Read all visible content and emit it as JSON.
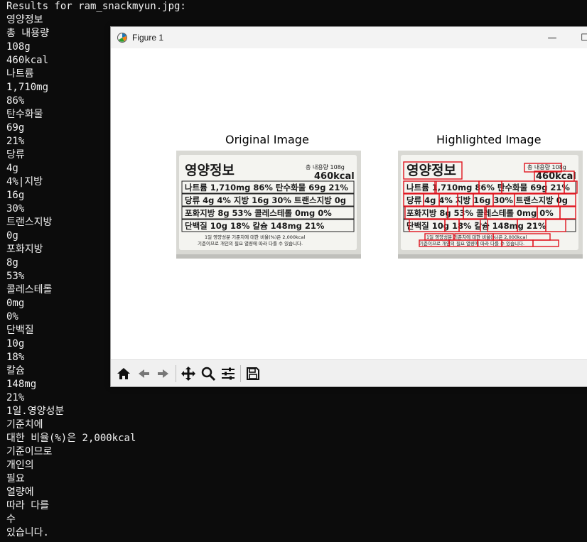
{
  "terminal": {
    "lines": [
      "Results for ram_snackmyun.jpg:",
      "영양정보",
      "총 내용량",
      "108g",
      "460kcal",
      "나트륨",
      "1,710mg",
      "86%",
      "탄수화물",
      "69g",
      "21%",
      "당류",
      "4g",
      "4%|지방",
      "16g",
      "30%",
      "트랜스지방",
      "0g",
      "포화지방",
      "8g",
      "53%",
      "콜레스테롤",
      "0mg",
      "0%",
      "단백질",
      "10g",
      "18%",
      "칼슘",
      "148mg",
      "21%",
      "1일.영양성분",
      "기준치에",
      "대한 비율(%)은 2,000kcal",
      "기준이므로",
      "개인의",
      "필요",
      "열량에",
      "따라 다를",
      "수",
      "있습니다."
    ]
  },
  "figure": {
    "window_title": "Figure 1",
    "minimize_glyph": "—",
    "maximize_glyph": "☐",
    "original_title": "Original Image",
    "highlighted_title": "Highlighted Image"
  },
  "label": {
    "heading": "영양정보",
    "total": "총 내용량 108g",
    "kcal": "460kcal",
    "row1": "나트륨 1,710mg 86% 탄수화물 69g 21%",
    "row2": "당류 4g 4% 지방 16g 30% 트랜스지방 0g",
    "row3": "포화지방 8g 53% 콜레스테롤 0mg 0%",
    "row4": "단백질 10g 18% 칼슘 148mg 21%",
    "foot1": "1일 영양성분 기준치에 대한 비율(%)은 2,000kcal",
    "foot2": "기준이므로 개인의 필요 열량에 따라 다를 수 있습니다."
  },
  "toolbar": {
    "icons": [
      "home-icon",
      "back-icon",
      "forward-icon",
      "pan-icon",
      "zoom-icon",
      "configure-icon",
      "save-icon"
    ]
  },
  "colors": {
    "terminal_bg": "#0c0c0c",
    "terminal_fg": "#f2f2f2",
    "highlight_box": "#e0141e"
  }
}
